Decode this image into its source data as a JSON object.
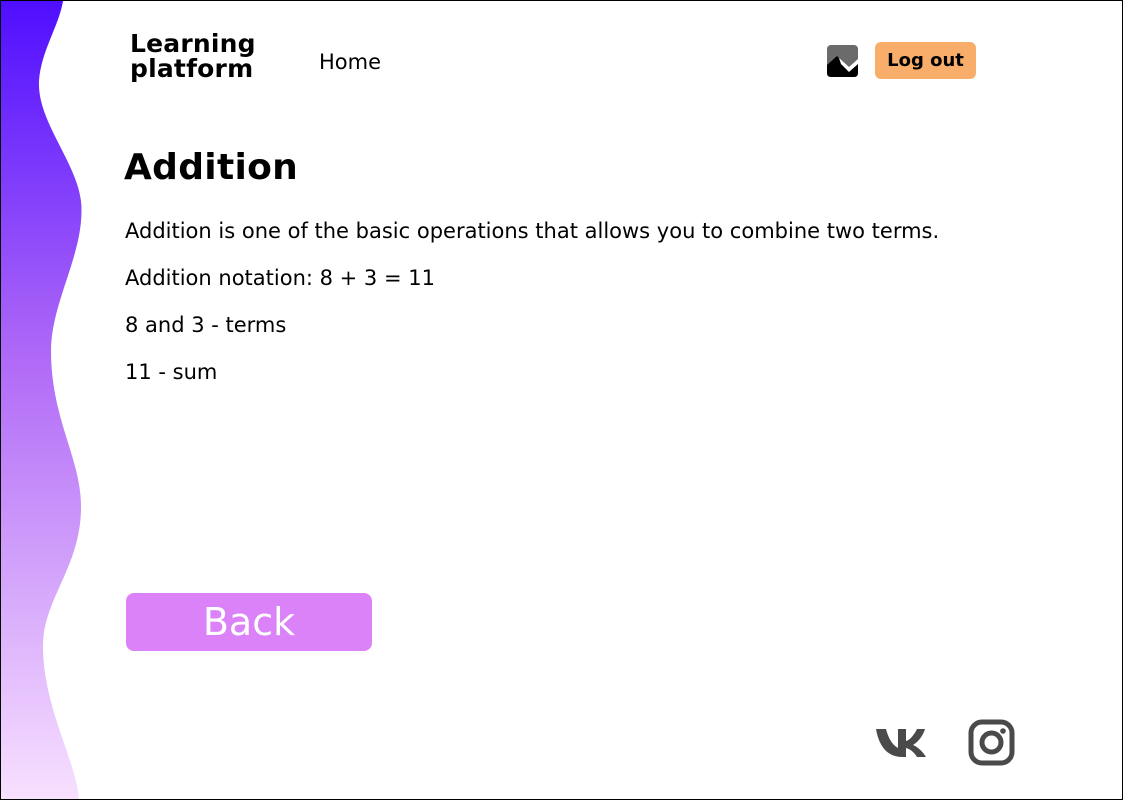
{
  "header": {
    "logo_line1": "Learning",
    "logo_line2": "platform",
    "nav_home": "Home",
    "avatar_icon": "avatar-image-icon",
    "logout_label": "Log out"
  },
  "main": {
    "title": "Addition",
    "paragraphs": [
      "Addition is one of the basic operations that allows you to combine two terms. Addition notation: 8 + 3 = 11",
      "8 and 3 - terms",
      "11 - sum"
    ],
    "back_label": "Back"
  },
  "footer": {
    "social": [
      "vk-icon",
      "instagram-icon"
    ]
  },
  "colors": {
    "accent_orange": "#f8ad6a",
    "back_button": "#dc82f9",
    "wave_top": "#4f0eff",
    "wave_bottom": "#f8e0ff",
    "icon_gray": "#4a4a4a"
  }
}
